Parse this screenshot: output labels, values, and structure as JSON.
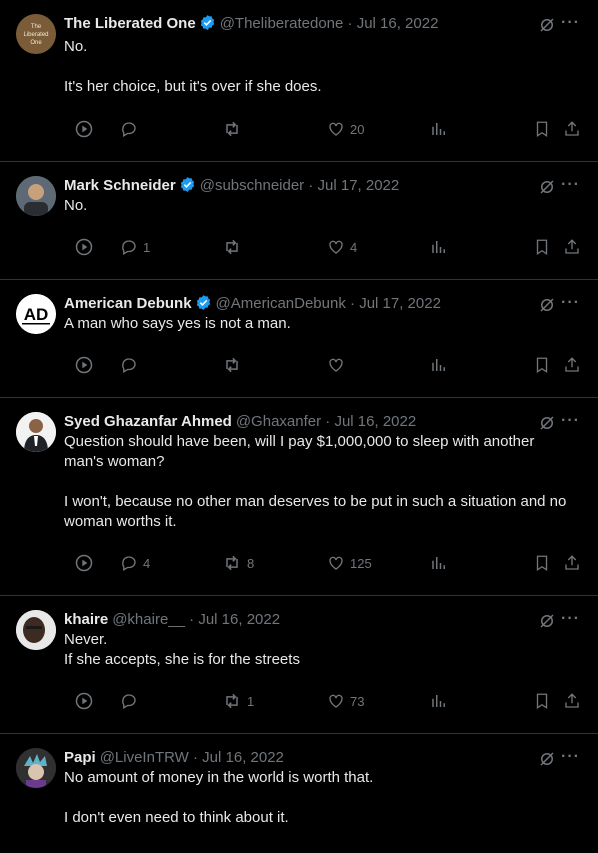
{
  "colors": {
    "background": "#000000",
    "text": "#e7e9ea",
    "muted": "#71767b",
    "verified": "#1d9bf0",
    "divider": "#2f3336"
  },
  "tweets": [
    {
      "name": "The Liberated One",
      "verified": true,
      "handle": "@Theliberatedone",
      "date": "Jul 16, 2022",
      "avatar_text": "The\nLiberated\nOne",
      "lines": [
        "No.",
        "",
        "It's her choice, but it's over if she does."
      ],
      "replies": "",
      "reposts": "",
      "likes": "20"
    },
    {
      "name": "Mark Schneider",
      "verified": true,
      "handle": "@subschneider",
      "date": "Jul 17, 2022",
      "avatar_text": "",
      "lines": [
        "No."
      ],
      "replies": "1",
      "reposts": "",
      "likes": "4"
    },
    {
      "name": "American Debunk",
      "verified": true,
      "handle": "@AmericanDebunk",
      "date": "Jul 17, 2022",
      "avatar_text": "AD",
      "lines": [
        "A man who says yes is not a man."
      ],
      "replies": "",
      "reposts": "",
      "likes": ""
    },
    {
      "name": "Syed Ghazanfar Ahmed",
      "verified": false,
      "handle": "@Ghaxanfer",
      "date": "Jul 16, 2022",
      "avatar_text": "",
      "lines": [
        "Question should have been, will I pay $1,000,000 to sleep with another",
        "man's woman?",
        "",
        "I won't, because no other man deserves to be put in such a situation and no",
        "woman worths it."
      ],
      "replies": "4",
      "reposts": "8",
      "likes": "125"
    },
    {
      "name": "khaire",
      "verified": false,
      "handle": "@khaire__",
      "date": "Jul 16, 2022",
      "avatar_text": "",
      "lines": [
        "Never.",
        "If she accepts, she is for the streets"
      ],
      "replies": "",
      "reposts": "1",
      "likes": "73"
    },
    {
      "name": "Papi",
      "verified": false,
      "handle": "@LiveInTRW",
      "date": "Jul 16, 2022",
      "avatar_text": "",
      "lines": [
        "No amount of money in the world is worth that.",
        "",
        "I don't even need to think about it."
      ],
      "replies": "",
      "reposts": "",
      "likes": ""
    }
  ]
}
